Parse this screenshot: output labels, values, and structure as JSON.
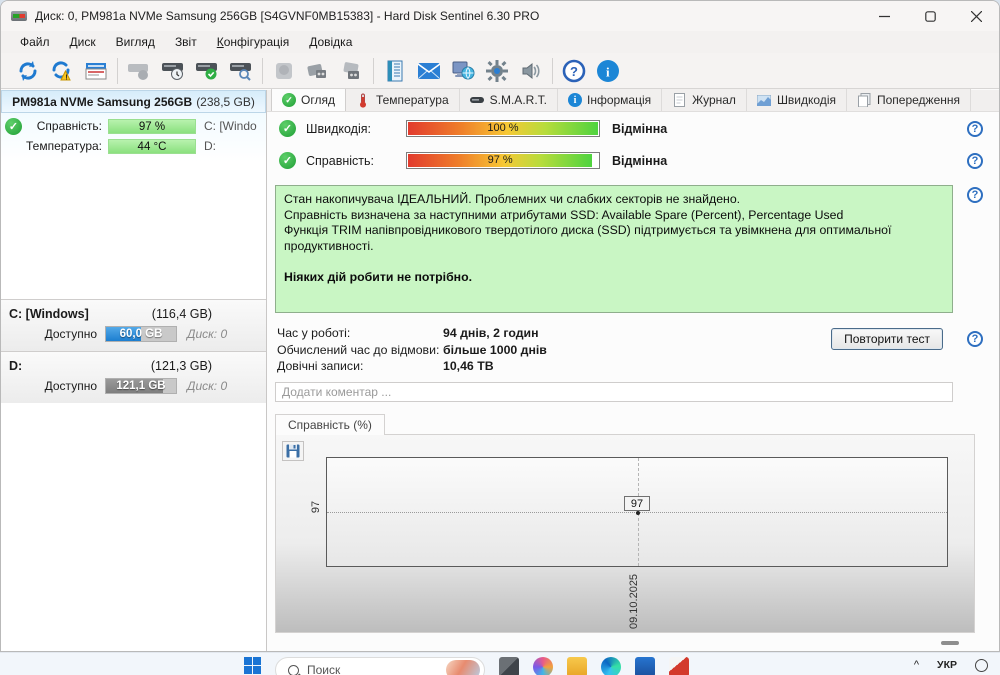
{
  "window": {
    "title": "Диск: 0, PM981a NVMe Samsung 256GB [S4GVNF0MB15383]  -  Hard Disk Sentinel 6.30 PRO"
  },
  "menu": {
    "items": [
      "Файл",
      "Диск",
      "Вигляд",
      "Звіт",
      "Довідка"
    ],
    "config_prefix": "К",
    "config_rest": "онфігурація"
  },
  "sidebar": {
    "disk_name": "PM981a NVMe Samsung 256GB",
    "disk_size": "(238,5 GB)",
    "health_label": "Справність:",
    "health_value": "97 %",
    "health_extra": "C: [Windo",
    "temp_label": "Температура:",
    "temp_value": "44 °C",
    "temp_extra": "D:",
    "partitions": [
      {
        "name": "C: [Windows]",
        "size": "(116,4 GB)",
        "avail_label": "Доступно",
        "avail": "60,0 GB",
        "disk": "Диск: 0",
        "fill_pct": 50,
        "fill_kind": "blue"
      },
      {
        "name": "D:",
        "size": "(121,3 GB)",
        "avail_label": "Доступно",
        "avail": "121,1 GB",
        "disk": "Диск: 0",
        "fill_pct": 82,
        "fill_kind": "gray"
      }
    ]
  },
  "tabs": [
    {
      "label": "Огляд"
    },
    {
      "label": "Температура"
    },
    {
      "label": "S.M.A.R.T."
    },
    {
      "label": "Інформація"
    },
    {
      "label": "Журнал"
    },
    {
      "label": "Швидкодія"
    },
    {
      "label": "Попередження"
    }
  ],
  "overview": {
    "metrics": [
      {
        "label": "Швидкодія:",
        "value": "100 %",
        "rating": "Відмінна",
        "pct": 100
      },
      {
        "label": "Справність:",
        "value": "97 %",
        "rating": "Відмінна",
        "pct": 97
      }
    ],
    "status_lines": [
      "Стан накопичувача ІДЕАЛЬНИЙ. Проблемних чи слабких секторів не знайдено.",
      "Справність визначена за наступними атрибутами SSD:  Available Spare (Percent), Percentage Used",
      "Функція TRIM напівпровідникового твердотілого диска (SSD) підтримується та увімкнена для оптимальної продуктивності."
    ],
    "status_bold": "Ніяких дій робити не потрібно.",
    "stats": [
      {
        "label": "Час у роботі:",
        "value": "94 днів, 2 годин"
      },
      {
        "label": "Обчислений час до відмови:",
        "value": "більше 1000 днів"
      },
      {
        "label": "Довічні записи:",
        "value": "10,46 TB"
      }
    ],
    "retest_button": "Повторити тест",
    "comment_placeholder": "Додати коментар ...",
    "help_glyph": "?"
  },
  "chart": {
    "tab_label": "Справність (%)",
    "y_tick": "97",
    "point_label": "97",
    "x_tick": "09.10.2025",
    "chart_data": {
      "type": "line",
      "title": "Справність (%)",
      "x": [
        "09.10.2025"
      ],
      "values": [
        97
      ],
      "ylabel": "Справність (%)",
      "grid": "dotted"
    }
  },
  "taskbar": {
    "search_placeholder": "Поиск",
    "language": "УКР",
    "chevron": "^"
  }
}
